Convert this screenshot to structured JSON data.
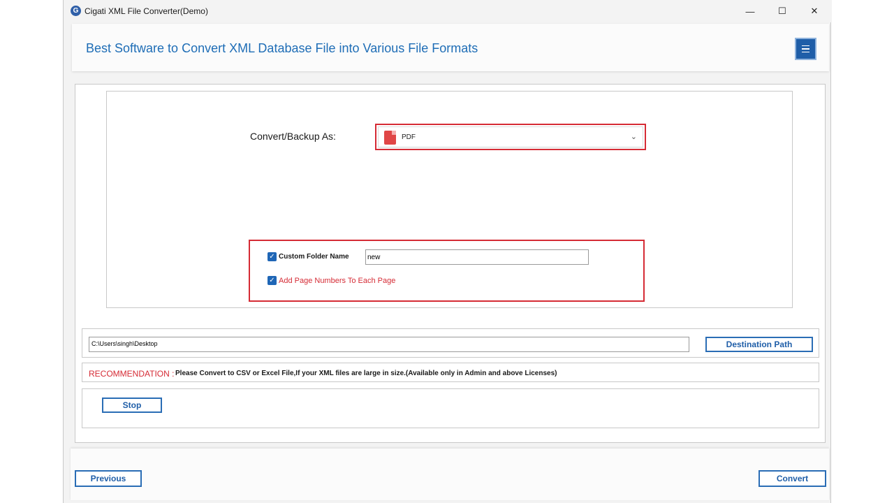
{
  "window": {
    "title": "Cigati XML File Converter(Demo)",
    "app_icon_letter": "G",
    "minimize": "—",
    "maximize": "☐",
    "close": "✕"
  },
  "header": {
    "title": "Best Software to Convert XML Database File into Various File Formats"
  },
  "convert": {
    "label": "Convert/Backup As:",
    "selected_format": "PDF"
  },
  "options": {
    "custom_folder": {
      "label": "Custom Folder Name",
      "checked": true,
      "value": "new"
    },
    "page_numbers": {
      "label": "Add Page Numbers To Each Page",
      "checked": true
    }
  },
  "destination": {
    "path": "C:\\Users\\singh\\Desktop",
    "button_label": "Destination Path"
  },
  "recommendation": {
    "label": "RECOMMENDATION :",
    "text": "Please Convert to CSV or Excel File,If your XML files are large in size.(Available only in Admin and above Licenses)"
  },
  "actions": {
    "stop_label": "Stop",
    "previous_label": "Previous",
    "convert_label": "Convert"
  },
  "colors": {
    "accent_blue": "#1f5ea8",
    "title_blue": "#1e6db6",
    "highlight_red": "#d52b35"
  }
}
